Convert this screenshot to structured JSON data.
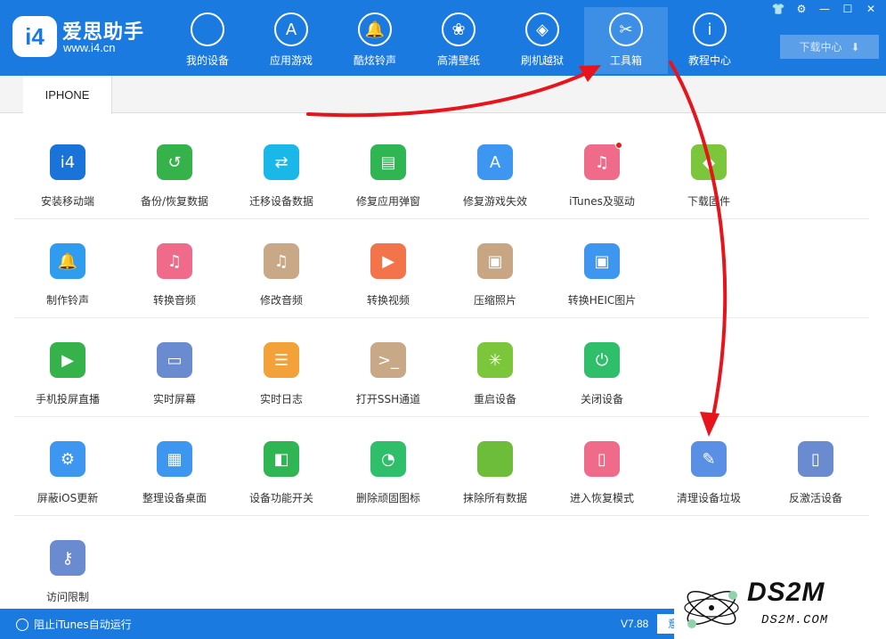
{
  "app": {
    "name": "爱思助手",
    "url": "www.i4.cn",
    "logo_text": "i4"
  },
  "nav": [
    {
      "label": "我的设备",
      "glyph": "",
      "icon": "apple-icon"
    },
    {
      "label": "应用游戏",
      "glyph": "A",
      "icon": "app-store-icon"
    },
    {
      "label": "酷炫铃声",
      "glyph": "🔔",
      "icon": "bell-icon"
    },
    {
      "label": "高清壁纸",
      "glyph": "❀",
      "icon": "flower-icon"
    },
    {
      "label": "刷机越狱",
      "glyph": "◈",
      "icon": "box-icon"
    },
    {
      "label": "工具箱",
      "glyph": "✂",
      "icon": "tools-icon",
      "active": true
    },
    {
      "label": "教程中心",
      "glyph": "i",
      "icon": "info-icon"
    }
  ],
  "window_controls": [
    "👕",
    "⚙",
    "—",
    "☐",
    "✕"
  ],
  "download_center": {
    "label": "下载中心",
    "glyph": "⬇"
  },
  "tab": {
    "label": "IPHONE"
  },
  "tools": [
    [
      {
        "label": "安装移动端",
        "color": "#1a73d9",
        "glyph": "i4",
        "icon": "i4-logo-icon"
      },
      {
        "label": "备份/恢复数据",
        "color": "#35b24a",
        "glyph": "↺",
        "icon": "backup-clock-icon"
      },
      {
        "label": "迁移设备数据",
        "color": "#1ab8e8",
        "glyph": "⇄",
        "icon": "transfer-phones-icon"
      },
      {
        "label": "修复应用弹窗",
        "color": "#2fb552",
        "glyph": "▤",
        "icon": "apple-id-icon"
      },
      {
        "label": "修复游戏失效",
        "color": "#3d97f0",
        "glyph": "A",
        "icon": "app-store-repair-icon"
      },
      {
        "label": "iTunes及驱动",
        "color": "#f06a8a",
        "glyph": "♫",
        "icon": "itunes-icon",
        "badge": true
      },
      {
        "label": "下载固件",
        "color": "#7bc63a",
        "glyph": "◆",
        "icon": "firmware-cube-icon"
      }
    ],
    [
      {
        "label": "制作铃声",
        "color": "#2f9cf0",
        "glyph": "🔔",
        "icon": "ringtone-bell-icon"
      },
      {
        "label": "转换音频",
        "color": "#f06a8a",
        "glyph": "♫",
        "icon": "audio-convert-icon"
      },
      {
        "label": "修改音频",
        "color": "#c8a886",
        "glyph": "♫",
        "icon": "audio-edit-icon"
      },
      {
        "label": "转换视频",
        "color": "#f3734a",
        "glyph": "▶",
        "icon": "video-convert-icon"
      },
      {
        "label": "压缩照片",
        "color": "#c9a683",
        "glyph": "▣",
        "icon": "photo-compress-icon"
      },
      {
        "label": "转换HEIC图片",
        "color": "#3d97f0",
        "glyph": "▣",
        "icon": "heic-convert-icon"
      }
    ],
    [
      {
        "label": "手机投屏直播",
        "color": "#35b24a",
        "glyph": "▶",
        "icon": "screen-cast-icon"
      },
      {
        "label": "实时屏幕",
        "color": "#6a8bd0",
        "glyph": "▭",
        "icon": "monitor-icon"
      },
      {
        "label": "实时日志",
        "color": "#f3a23a",
        "glyph": "☰",
        "icon": "log-document-icon"
      },
      {
        "label": "打开SSH通道",
        "color": "#c8a886",
        "glyph": ">_",
        "icon": "ssh-terminal-icon"
      },
      {
        "label": "重启设备",
        "color": "#7bc63a",
        "glyph": "✳",
        "icon": "restart-icon"
      },
      {
        "label": "关闭设备",
        "color": "#2fbf6a",
        "glyph": "⏻",
        "icon": "power-icon"
      }
    ],
    [
      {
        "label": "屏蔽iOS更新",
        "color": "#3d97f0",
        "glyph": "⚙",
        "icon": "block-update-gear-icon"
      },
      {
        "label": "整理设备桌面",
        "color": "#3d97f0",
        "glyph": "▦",
        "icon": "desktop-grid-icon"
      },
      {
        "label": "设备功能开关",
        "color": "#2fb552",
        "glyph": "◧",
        "icon": "feature-toggle-icon"
      },
      {
        "label": "删除顽固图标",
        "color": "#2fbf6a",
        "glyph": "◔",
        "icon": "delete-icon-pie-icon"
      },
      {
        "label": "抹除所有数据",
        "color": "#6dbd3a",
        "glyph": "",
        "icon": "erase-apple-icon"
      },
      {
        "label": "进入恢复模式",
        "color": "#f06a8a",
        "glyph": "▯",
        "icon": "recovery-mode-icon"
      },
      {
        "label": "清理设备垃圾",
        "color": "#5a8fe6",
        "glyph": "✎",
        "icon": "cleaner-broom-icon"
      },
      {
        "label": "反激活设备",
        "color": "#6a8bd0",
        "glyph": "▯",
        "icon": "deactivate-icon"
      }
    ],
    [
      {
        "label": "访问限制",
        "color": "#6a8bd0",
        "glyph": "⚷",
        "icon": "access-key-icon"
      }
    ]
  ],
  "statusbar": {
    "itunes_label": "阻止iTunes自动运行",
    "version": "V7.88",
    "feedback_label": "意"
  },
  "watermark": {
    "title": "DS2M",
    "url": "DS2M.COM"
  },
  "annotation_color": "#e8141c"
}
